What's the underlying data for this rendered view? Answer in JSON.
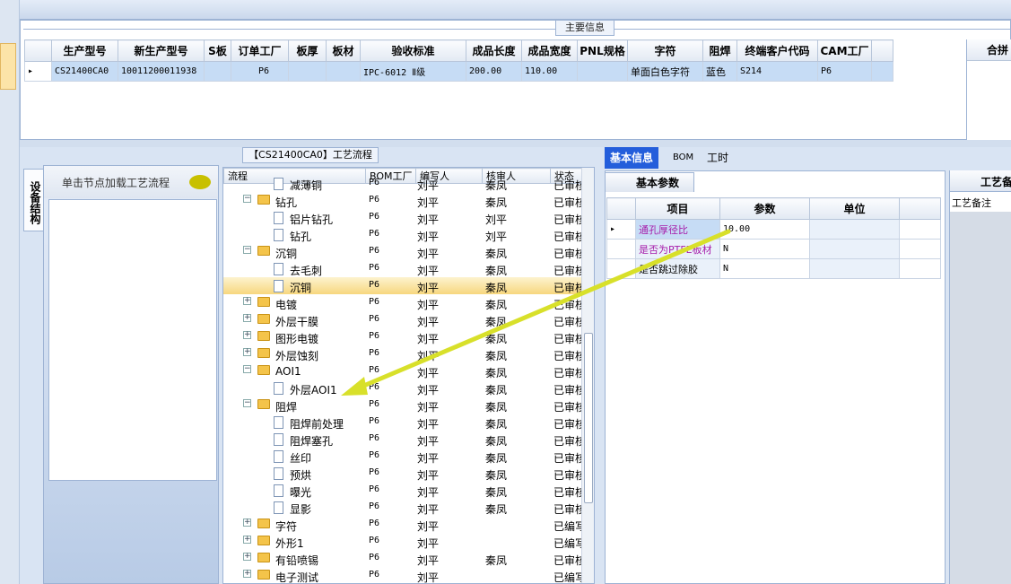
{
  "main_info": {
    "title": "主要信息",
    "headers": [
      "生产型号",
      "新生产型号",
      "S板",
      "订单工厂",
      "板厚",
      "板材",
      "验收标准",
      "成品长度",
      "成品宽度",
      "PNL规格",
      "字符",
      "阻焊",
      "终端客户代码",
      "CAM工厂"
    ],
    "row": [
      "CS21400CA0",
      "10011200011938",
      "",
      "P6",
      "",
      "",
      "IPC-6012 Ⅱ级",
      "200.00",
      "110.00",
      "",
      "单面白色字符",
      "蓝色",
      "S214",
      "P6"
    ],
    "side_header": "合拼"
  },
  "left_panel": {
    "vertical_tab": "设备结构",
    "hint": "单击节点加载工艺流程"
  },
  "tree": {
    "title": "【CS21400CA0】工艺流程",
    "headers": [
      "流程",
      "BOM工厂",
      "编写人",
      "核审人",
      "状态"
    ],
    "rows": [
      {
        "level": 1,
        "kind": "doc",
        "name": "减薄铜",
        "bom": "P6",
        "writer": "刘平",
        "checker": "秦凤",
        "status": "已审核"
      },
      {
        "level": 0,
        "kind": "folder",
        "exp": "−",
        "name": "钻孔",
        "bom": "P6",
        "writer": "刘平",
        "checker": "秦凤",
        "status": "已审核"
      },
      {
        "level": 1,
        "kind": "doc",
        "name": "铝片钻孔",
        "bom": "P6",
        "writer": "刘平",
        "checker": "刘平",
        "status": "已审核"
      },
      {
        "level": 1,
        "kind": "doc",
        "name": "钻孔",
        "bom": "P6",
        "writer": "刘平",
        "checker": "刘平",
        "status": "已审核"
      },
      {
        "level": 0,
        "kind": "folder",
        "exp": "−",
        "name": "沉铜",
        "bom": "P6",
        "writer": "刘平",
        "checker": "秦凤",
        "status": "已审核"
      },
      {
        "level": 1,
        "kind": "doc",
        "name": "去毛刺",
        "bom": "P6",
        "writer": "刘平",
        "checker": "秦凤",
        "status": "已审核"
      },
      {
        "level": 1,
        "kind": "doc",
        "name": "沉铜",
        "bom": "P6",
        "writer": "刘平",
        "checker": "秦凤",
        "status": "已审核",
        "selected": true
      },
      {
        "level": 0,
        "kind": "folder",
        "exp": "+",
        "name": "电镀",
        "bom": "P6",
        "writer": "刘平",
        "checker": "秦凤",
        "status": "已审核"
      },
      {
        "level": 0,
        "kind": "folder",
        "exp": "+",
        "name": "外层干膜",
        "bom": "P6",
        "writer": "刘平",
        "checker": "秦凤",
        "status": "已审核"
      },
      {
        "level": 0,
        "kind": "folder",
        "exp": "+",
        "name": "图形电镀",
        "bom": "P6",
        "writer": "刘平",
        "checker": "秦凤",
        "status": "已审核"
      },
      {
        "level": 0,
        "kind": "folder",
        "exp": "+",
        "name": "外层蚀刻",
        "bom": "P6",
        "writer": "刘平",
        "checker": "秦凤",
        "status": "已审核"
      },
      {
        "level": 0,
        "kind": "folder",
        "exp": "−",
        "name": "AOI1",
        "bom": "P6",
        "writer": "刘平",
        "checker": "秦凤",
        "status": "已审核"
      },
      {
        "level": 1,
        "kind": "doc",
        "name": "外层AOI1",
        "bom": "P6",
        "writer": "刘平",
        "checker": "秦凤",
        "status": "已审核"
      },
      {
        "level": 0,
        "kind": "folder",
        "exp": "−",
        "name": "阻焊",
        "bom": "P6",
        "writer": "刘平",
        "checker": "秦凤",
        "status": "已审核"
      },
      {
        "level": 1,
        "kind": "doc",
        "name": "阻焊前处理",
        "bom": "P6",
        "writer": "刘平",
        "checker": "秦凤",
        "status": "已审核"
      },
      {
        "level": 1,
        "kind": "doc",
        "name": "阻焊塞孔",
        "bom": "P6",
        "writer": "刘平",
        "checker": "秦凤",
        "status": "已审核"
      },
      {
        "level": 1,
        "kind": "doc",
        "name": "丝印",
        "bom": "P6",
        "writer": "刘平",
        "checker": "秦凤",
        "status": "已审核"
      },
      {
        "level": 1,
        "kind": "doc",
        "name": "预烘",
        "bom": "P6",
        "writer": "刘平",
        "checker": "秦凤",
        "status": "已审核"
      },
      {
        "level": 1,
        "kind": "doc",
        "name": "曝光",
        "bom": "P6",
        "writer": "刘平",
        "checker": "秦凤",
        "status": "已审核"
      },
      {
        "level": 1,
        "kind": "doc",
        "name": "显影",
        "bom": "P6",
        "writer": "刘平",
        "checker": "秦凤",
        "status": "已审核"
      },
      {
        "level": 0,
        "kind": "folder",
        "exp": "+",
        "name": "字符",
        "bom": "P6",
        "writer": "刘平",
        "checker": "",
        "status": "已编写"
      },
      {
        "level": 0,
        "kind": "folder",
        "exp": "+",
        "name": "外形1",
        "bom": "P6",
        "writer": "刘平",
        "checker": "",
        "status": "已编写"
      },
      {
        "level": 0,
        "kind": "folder",
        "exp": "+",
        "name": "有铅喷锡",
        "bom": "P6",
        "writer": "刘平",
        "checker": "秦凤",
        "status": "已审核"
      },
      {
        "level": 0,
        "kind": "folder",
        "exp": "+",
        "name": "电子测试",
        "bom": "P6",
        "writer": "刘平",
        "checker": "",
        "status": "已编写"
      }
    ]
  },
  "right": {
    "tabs": [
      "基本信息",
      "BOM",
      "工时"
    ],
    "subtab": "基本参数",
    "param_headers": [
      "项目",
      "参数",
      "单位"
    ],
    "params": [
      {
        "item": "通孔厚径比",
        "value": "10.00",
        "unit": ""
      },
      {
        "item": "是否为PTFE板材",
        "value": "N",
        "unit": ""
      },
      {
        "item": "是否跳过除胶",
        "value": "N",
        "unit": ""
      }
    ],
    "side_header": "工艺备",
    "side_body": "工艺备注"
  }
}
